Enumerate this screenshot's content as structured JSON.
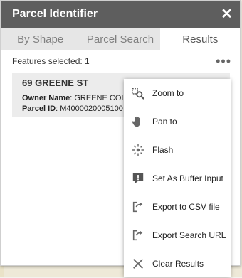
{
  "panel": {
    "title": "Parcel Identifier",
    "close_label": "✕"
  },
  "tabs": [
    {
      "label": "By Shape",
      "active": false
    },
    {
      "label": "Parcel Search",
      "active": false
    },
    {
      "label": "Results",
      "active": true
    }
  ],
  "toolbar": {
    "features_selected": "Features selected: 1",
    "more_label": "•••"
  },
  "result": {
    "title": "69 GREENE ST",
    "owner_label": "Owner Name",
    "owner_value": ": GREENE COI",
    "parcel_label": "Parcel ID",
    "parcel_value": ": M4000020005100",
    "more_label": "•••"
  },
  "menu": {
    "items": [
      {
        "label": "Zoom to",
        "icon": "zoom-to-icon"
      },
      {
        "label": "Pan to",
        "icon": "pan-hand-icon"
      },
      {
        "label": "Flash",
        "icon": "flash-icon"
      },
      {
        "label": "Set As Buffer Input",
        "icon": "buffer-alert-icon"
      },
      {
        "label": "Export to CSV file",
        "icon": "export-icon"
      },
      {
        "label": "Export Search URL",
        "icon": "export-icon"
      },
      {
        "label": "Clear Results",
        "icon": "clear-x-icon"
      }
    ]
  },
  "colors": {
    "titlebar": "#5e5e5e",
    "tab_inactive": "#e6e6e6",
    "result_bg": "#ececec"
  }
}
